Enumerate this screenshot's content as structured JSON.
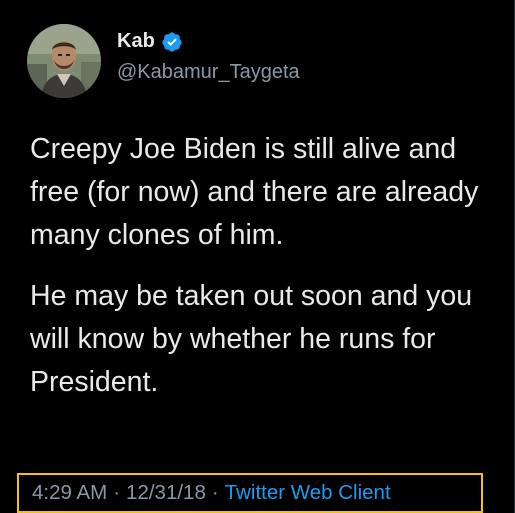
{
  "author": {
    "display_name": "Kab",
    "handle": "@Kabamur_Taygeta",
    "verified_icon": "verified-badge-icon",
    "avatar": "avatar-photo"
  },
  "tweet": {
    "paragraphs": [
      "Creepy Joe Biden is still alive and free (for now) and there are already many clones of him.",
      "He may be taken out soon and you will know by whether he runs for President."
    ]
  },
  "meta": {
    "time": "4:29 AM",
    "separator": "·",
    "date": "12/31/18",
    "client": "Twitter Web Client"
  },
  "colors": {
    "background": "#000000",
    "text": "#e7e9ea",
    "muted": "#8b98a5",
    "link": "#1d9bf0",
    "verified": "#1d9bf0",
    "highlight_border": "#f4c20d"
  }
}
